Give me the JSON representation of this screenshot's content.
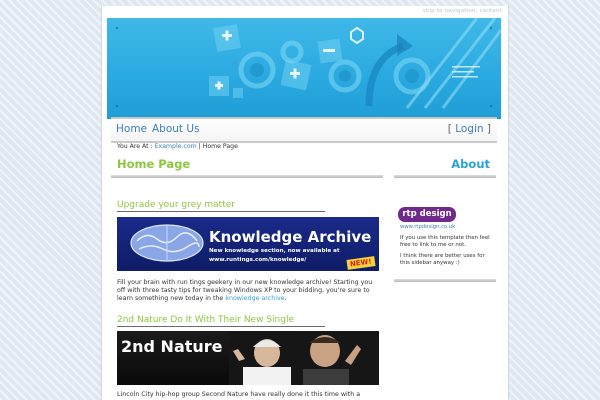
{
  "skip": {
    "text1": "skip to navigation",
    "sep": ",",
    "text2": "content"
  },
  "nav": {
    "home": "Home",
    "about": "About Us",
    "login_open": "[",
    "login": "Login",
    "login_close": "]"
  },
  "breadcrumb": {
    "label": "You Are At :",
    "link": "Example.com",
    "sep": "|",
    "current": "Home Page"
  },
  "main": {
    "title": "Home Page",
    "articles": [
      {
        "heading": "Upgrade your grey matter",
        "image": {
          "title": "Knowledge Archive",
          "line1": "New knowledge section, now available at",
          "line2": "www.runtings.com/knowledge/",
          "badge": "NEW!"
        },
        "text": "Fill your brain with run tings geekery in our new knowledge archive! Starting you off with three tasty tips for tweaking Windows XP to your bidding, you're sure to learn something new today in the",
        "link": "knowledge archive",
        "tail": "."
      },
      {
        "heading": "2nd Nature Do It With Their New Single",
        "image": {
          "title": "2nd Nature"
        },
        "text": "Lincoln City hip-hop group Second Nature have really done it this time with a"
      }
    ]
  },
  "sidebar": {
    "title": "About",
    "logo": "rtp design",
    "logo_url": "www.rtpdesign.co.uk",
    "para1": "If you use this template then feel free to link to me or not.",
    "para2": "I think there are better uses for this sidebar anyway :)"
  },
  "colors": {
    "green": "#8cc63f",
    "blue": "#29a3d6",
    "link": "#3a7dbf",
    "banner": "#2aa9e0"
  }
}
